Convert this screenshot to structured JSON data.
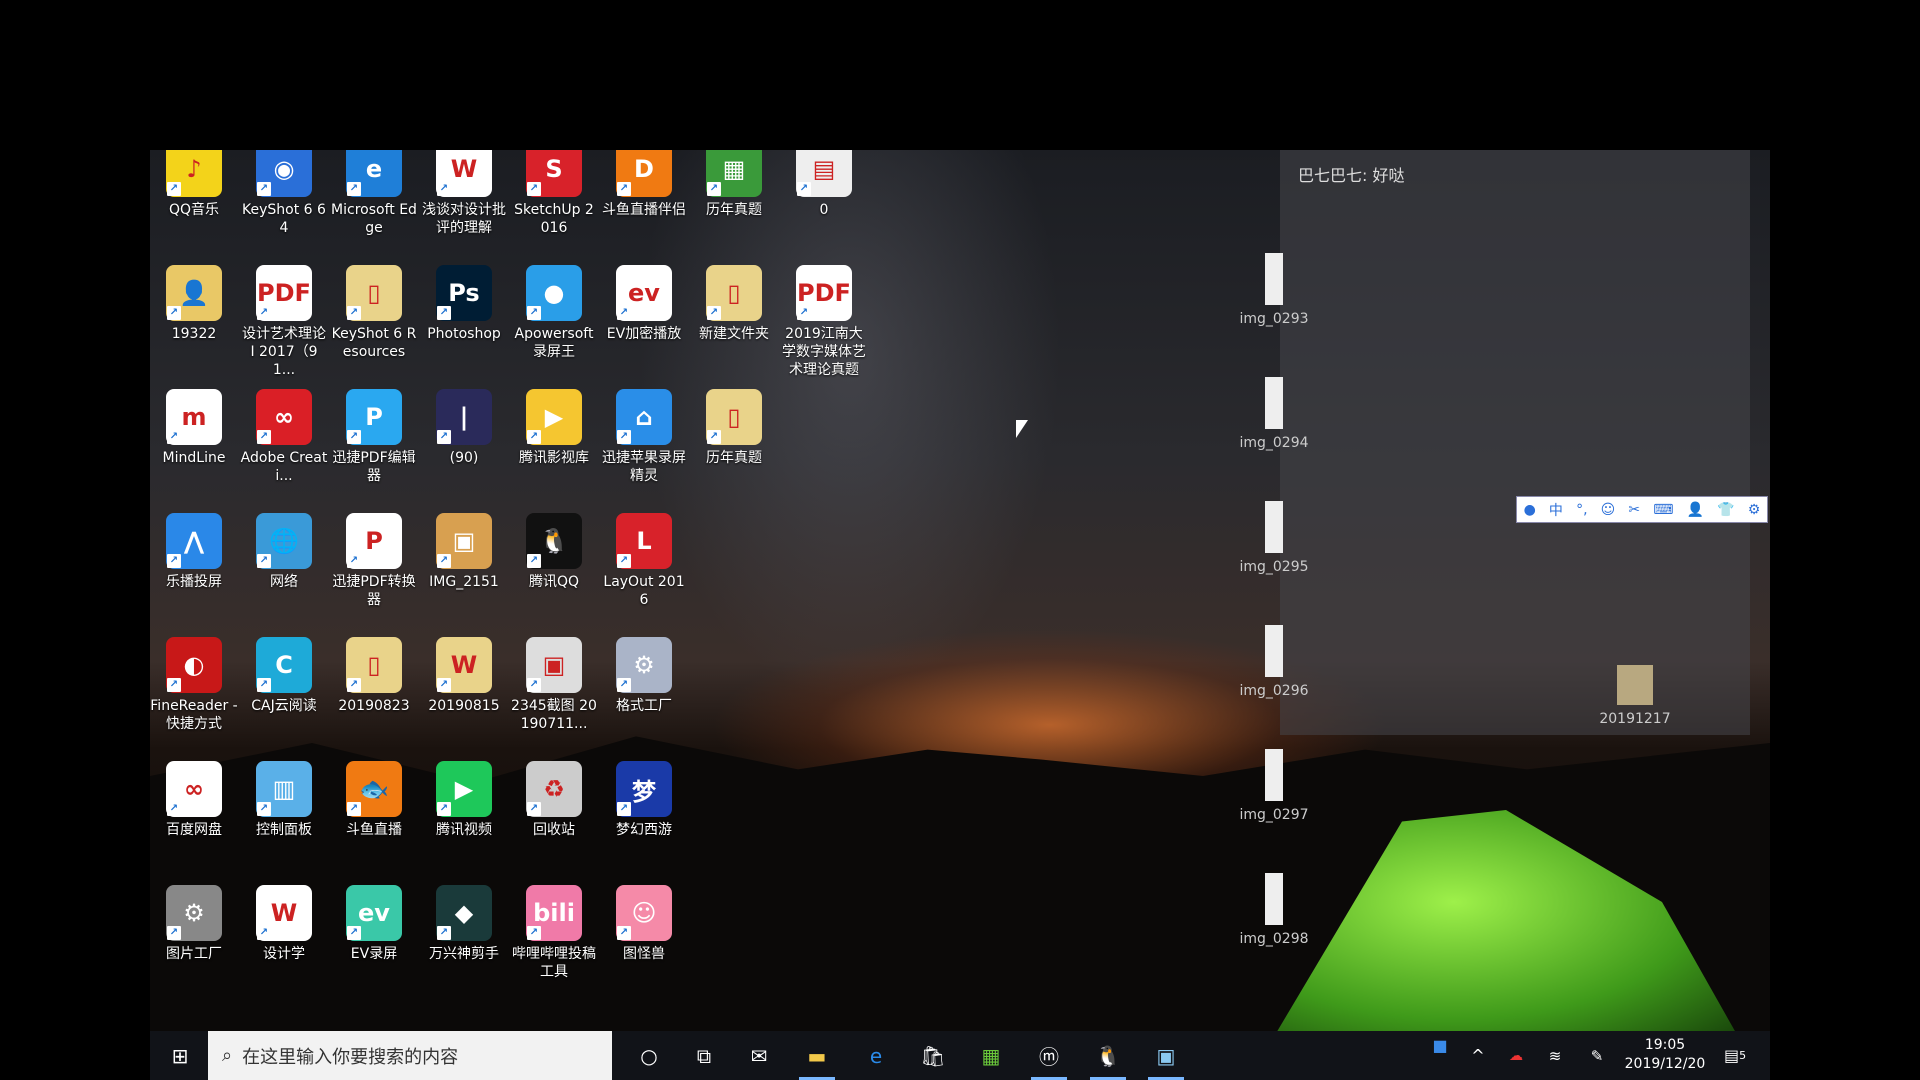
{
  "chat_overlay": "巴七巴七: 好哒",
  "desktop_icons": [
    [
      {
        "label": "QQ音乐",
        "color": "#f3d31a",
        "glyph": "♪"
      },
      {
        "label": "KeyShot 6 64",
        "color": "#2a6fd8",
        "glyph": "◉"
      },
      {
        "label": "Microsoft Edge",
        "color": "#1f7fd8",
        "glyph": "e"
      },
      {
        "label": "浅谈对设计批评的理解",
        "color": "#ffffff",
        "glyph": "W"
      },
      {
        "label": "SketchUp 2016",
        "color": "#d8222a",
        "glyph": "S"
      },
      {
        "label": "斗鱼直播伴侣",
        "color": "#f07a12",
        "glyph": "D"
      },
      {
        "label": "历年真题",
        "color": "#3a9a3a",
        "glyph": "▦"
      },
      {
        "label": "0",
        "color": "#eeeeee",
        "glyph": "▤"
      }
    ],
    [
      {
        "label": "19322",
        "color": "#e9c866",
        "glyph": "👤"
      },
      {
        "label": "设计艺术理论 I 2017（91...",
        "color": "#ffffff",
        "glyph": "PDF"
      },
      {
        "label": "KeyShot 6 Resources",
        "color": "#e9d38a",
        "glyph": "▯"
      },
      {
        "label": "Photoshop",
        "color": "#001d34",
        "glyph": "Ps"
      },
      {
        "label": "Apowersoft 录屏王",
        "color": "#2a9ee8",
        "glyph": "●"
      },
      {
        "label": "EV加密播放",
        "color": "#ffffff",
        "glyph": "ev"
      },
      {
        "label": "新建文件夹",
        "color": "#e9d38a",
        "glyph": "▯"
      },
      {
        "label": "2019江南大学数字媒体艺术理论真题",
        "color": "#ffffff",
        "glyph": "PDF"
      }
    ],
    [
      {
        "label": "MindLine",
        "color": "#ffffff",
        "glyph": "m"
      },
      {
        "label": "Adobe Creati...",
        "color": "#da1f26",
        "glyph": "∞"
      },
      {
        "label": "迅捷PDF编辑器",
        "color": "#2aa8f0",
        "glyph": "P"
      },
      {
        "label": "(90)",
        "color": "#2a2a5a",
        "glyph": "|"
      },
      {
        "label": "腾讯影视库",
        "color": "#f5c630",
        "glyph": "▶"
      },
      {
        "label": "迅捷苹果录屏精灵",
        "color": "#2a8ee8",
        "glyph": "⌂"
      },
      {
        "label": "历年真题",
        "color": "#e9d38a",
        "glyph": "▯"
      }
    ],
    [
      {
        "label": "乐播投屏",
        "color": "#2a88e8",
        "glyph": "⋀"
      },
      {
        "label": "网络",
        "color": "#3a9ad8",
        "glyph": "🌐"
      },
      {
        "label": "迅捷PDF转换器",
        "color": "#ffffff",
        "glyph": "P"
      },
      {
        "label": "IMG_2151",
        "color": "#d8a050",
        "glyph": "▣"
      },
      {
        "label": "腾讯QQ",
        "color": "#111111",
        "glyph": "🐧"
      },
      {
        "label": "LayOut 2016",
        "color": "#d8222a",
        "glyph": "L"
      }
    ],
    [
      {
        "label": "FineReader - 快捷方式",
        "color": "#c81818",
        "glyph": "◐"
      },
      {
        "label": "CAJ云阅读",
        "color": "#1eaad8",
        "glyph": "C"
      },
      {
        "label": "20190823",
        "color": "#e9d38a",
        "glyph": "▯"
      },
      {
        "label": "20190815",
        "color": "#e9d38a",
        "glyph": "W"
      },
      {
        "label": "2345截图 20190711...",
        "color": "#dddddd",
        "glyph": "▣"
      },
      {
        "label": "格式工厂",
        "color": "#aab4c8",
        "glyph": "⚙"
      }
    ],
    [
      {
        "label": "百度网盘",
        "color": "#ffffff",
        "glyph": "∞"
      },
      {
        "label": "控制面板",
        "color": "#5ab0e8",
        "glyph": "▥"
      },
      {
        "label": "斗鱼直播",
        "color": "#f07a12",
        "glyph": "🐟"
      },
      {
        "label": "腾讯视频",
        "color": "#1ec85a",
        "glyph": "▶"
      },
      {
        "label": "回收站",
        "color": "#cccccc",
        "glyph": "♻"
      },
      {
        "label": "梦幻西游",
        "color": "#1a3aa8",
        "glyph": "梦"
      }
    ],
    [
      {
        "label": "图片工厂",
        "color": "#888888",
        "glyph": "⚙"
      },
      {
        "label": "设计学",
        "color": "#ffffff",
        "glyph": "W"
      },
      {
        "label": "EV录屏",
        "color": "#3ac8a8",
        "glyph": "ev"
      },
      {
        "label": "万兴神剪手",
        "color": "#1a3a3a",
        "glyph": "◆"
      },
      {
        "label": "哔哩哔哩投稿工具",
        "color": "#f07aa8",
        "glyph": "bili"
      },
      {
        "label": "图怪兽",
        "color": "#f58aa8",
        "glyph": "☺"
      }
    ]
  ],
  "right_files": [
    "img_0293",
    "img_0294",
    "img_0295",
    "img_0296",
    "img_0297",
    "img_0298"
  ],
  "folder_20191217": "20191217",
  "ime_toolbar": [
    "user",
    "中",
    "°,",
    "☺",
    "✂",
    "⌨",
    "👤",
    "👕",
    "⚙"
  ],
  "taskbar": {
    "search_placeholder": "在这里输入你要搜索的内容",
    "apps": [
      "cortana",
      "task-view",
      "mail",
      "file-explorer",
      "edge",
      "store",
      "spreadsheet",
      "mindline",
      "qq",
      "screenshot"
    ],
    "time": "19:05",
    "date": "2019/12/20",
    "notifications": "5"
  }
}
